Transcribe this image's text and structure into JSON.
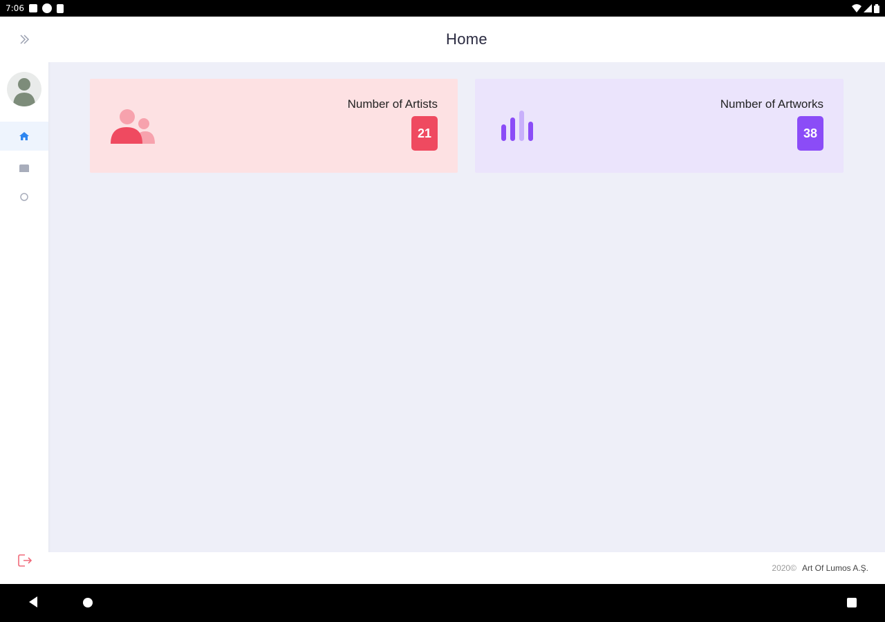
{
  "status_bar": {
    "time": "7:06"
  },
  "header": {
    "title": "Home"
  },
  "sidebar": {
    "expand_icon": "chevron-double-right-icon",
    "avatar_icon": "user-avatar-icon",
    "items": [
      {
        "icon": "home-icon",
        "active": true
      },
      {
        "icon": "folder-icon",
        "active": false
      },
      {
        "icon": "circle-icon",
        "active": false
      }
    ],
    "logout_icon": "logout-icon"
  },
  "cards": {
    "artists": {
      "label": "Number of Artists",
      "count": "21",
      "icon": "users-icon",
      "accent": "#ef4a60"
    },
    "artworks": {
      "label": "Number of Artworks",
      "count": "38",
      "icon": "bar-chart-icon",
      "accent": "#8b4cf7"
    }
  },
  "footer": {
    "year": "2020©",
    "company": "Art Of Lumos A.Ş."
  }
}
